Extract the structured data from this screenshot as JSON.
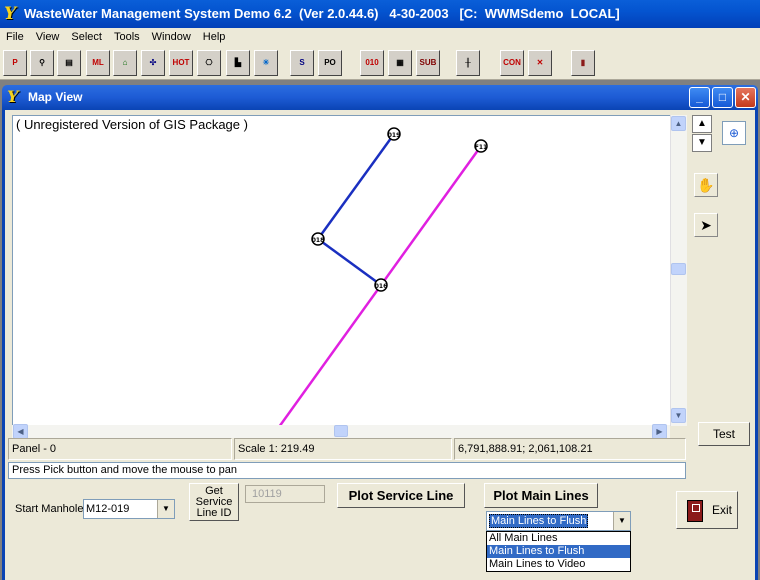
{
  "app": {
    "title": "WasteWater Management System Demo 6.2  (Ver 2.0.44.6)   4-30-2003   [C:  WWMSdemo  LOCAL]",
    "logo_glyph": "Y"
  },
  "menu": [
    "File",
    "View",
    "Select",
    "Tools",
    "Window",
    "Help"
  ],
  "toolbar": {
    "buttons": [
      {
        "name": "p-icon",
        "glyph": "P",
        "color": "#c00000"
      },
      {
        "name": "search-icon",
        "glyph": "⚲",
        "color": "#000"
      },
      {
        "name": "manhole-icon",
        "glyph": "▤",
        "color": "#000"
      },
      {
        "name": "ml-icon",
        "glyph": "ML",
        "color": "#c00000"
      },
      {
        "name": "house-icon",
        "glyph": "⌂",
        "color": "#006600"
      },
      {
        "name": "network-icon",
        "glyph": "✣",
        "color": "#000080"
      },
      {
        "name": "hot-icon",
        "glyph": "HOT",
        "color": "#c00000"
      },
      {
        "name": "camera-icon",
        "glyph": "⎔",
        "color": "#000"
      },
      {
        "name": "building-icon",
        "glyph": "▙",
        "color": "#000"
      },
      {
        "name": "lightbulb-icon",
        "glyph": "☀",
        "color": "#0066cc"
      },
      {
        "name": "route-icon",
        "glyph": "S",
        "color": "#000080"
      },
      {
        "name": "po-icon",
        "glyph": "PO",
        "color": "#000"
      },
      {
        "name": "binary-icon",
        "glyph": "010",
        "color": "#c00000"
      },
      {
        "name": "panel-icon",
        "glyph": "▦",
        "color": "#000"
      },
      {
        "name": "subdiv-icon",
        "glyph": "SUB",
        "color": "#800000"
      },
      {
        "name": "pipe-icon",
        "glyph": "╫",
        "color": "#000"
      },
      {
        "name": "contrib-icon",
        "glyph": "CON",
        "color": "#c00000"
      },
      {
        "name": "worker-icon",
        "glyph": "✕",
        "color": "#c00000"
      },
      {
        "name": "door-icon",
        "glyph": "▮",
        "color": "#8b1a1a"
      }
    ]
  },
  "map_window": {
    "title": "Map View",
    "unregistered_note": "( Unregistered Version of GIS Package )",
    "nodes": [
      {
        "label": "019"
      },
      {
        "label": "F11"
      },
      {
        "label": "018"
      },
      {
        "label": "016"
      }
    ],
    "line_colors": {
      "service": "#1a2fc0",
      "main": "#e020e0"
    }
  },
  "status": {
    "panel": "Panel - 0",
    "scale": "Scale 1: 219.49",
    "coords": "6,791,888.91; 2,061,108.21"
  },
  "message": "Press Pick button and move the mouse to pan",
  "controls": {
    "start_manhole_label": "Start Manhole",
    "start_manhole_value": "M12-019",
    "get_service_label": "Get Service Line ID",
    "service_line_id": "10119",
    "plot_service_label": "Plot Service Line",
    "plot_main_label": "Plot Main Lines",
    "main_lines_selected": "Main Lines to Flush",
    "main_lines_options": [
      "All Main Lines",
      "Main Lines to Flush",
      "Main Lines to Video"
    ],
    "test_label": "Test",
    "exit_label": "Exit"
  }
}
